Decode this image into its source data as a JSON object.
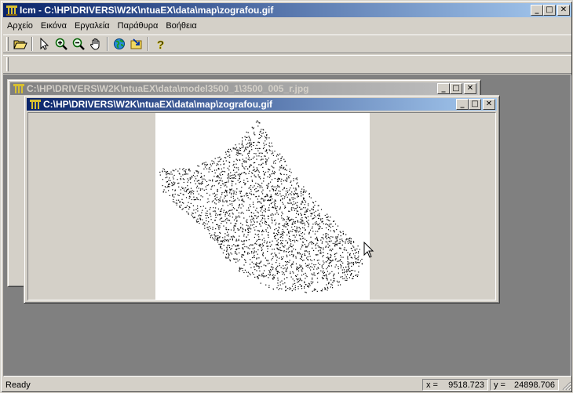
{
  "app": {
    "title": "Icm - C:\\HP\\DRIVERS\\W2K\\ntuaEX\\data\\map\\zografou.gif"
  },
  "caption_buttons": {
    "minimize": "_",
    "maximize": "□",
    "close": "✕"
  },
  "menu": [
    "Αρχείο",
    "Εικόνα",
    "Εργαλεία",
    "Παράθυρα",
    "Βοήθεια"
  ],
  "toolbar": [
    "open-folder-icon",
    "arrow-pointer-icon",
    "zoom-in-icon",
    "zoom-out-icon",
    "pan-hand-icon",
    "globe-icon",
    "folder-export-icon",
    "help-icon"
  ],
  "windows": [
    {
      "title": "C:\\HP\\DRIVERS\\W2K\\ntuaEX\\data\\model3500_1\\3500_005_r.jpg",
      "active": false
    },
    {
      "title": "C:\\HP\\DRIVERS\\W2K\\ntuaEX\\data\\map\\zografou.gif",
      "active": true
    }
  ],
  "status": {
    "ready": "Ready",
    "x_label": "x =",
    "x_value": "9518.723",
    "y_label": "y =",
    "y_value": "24898.706"
  }
}
